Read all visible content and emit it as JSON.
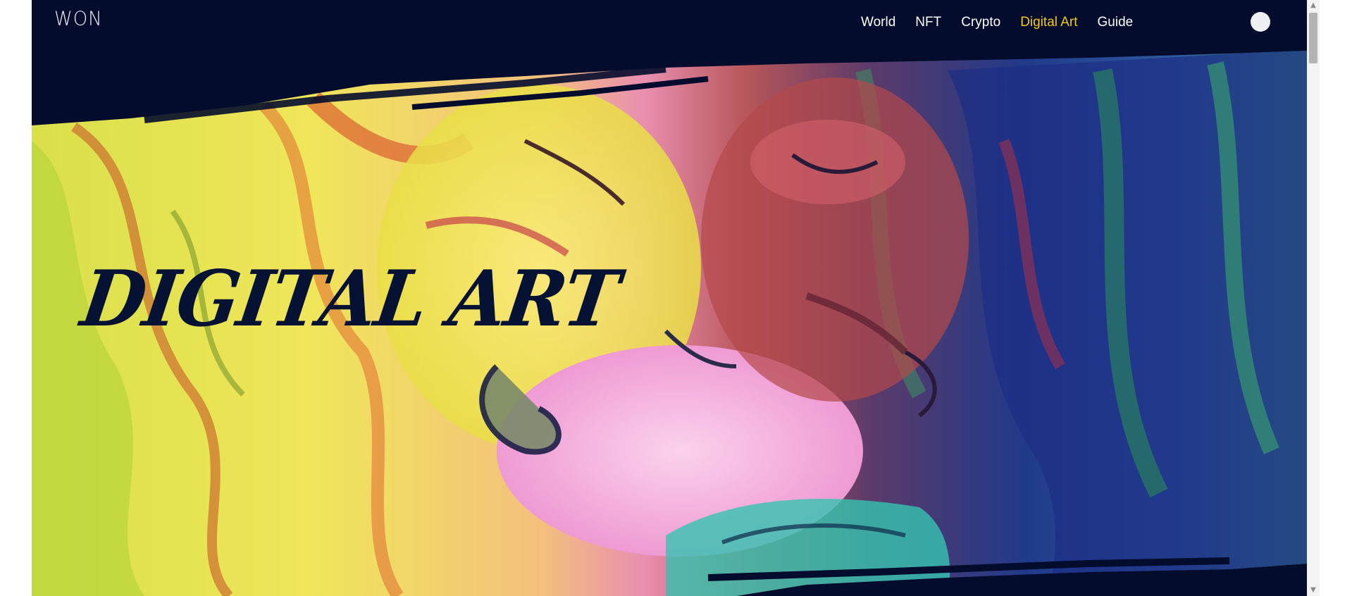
{
  "header": {
    "logo": "WON",
    "menu": [
      {
        "label": "World",
        "active": false
      },
      {
        "label": "NFT",
        "active": false
      },
      {
        "label": "Crypto",
        "active": false
      },
      {
        "label": "Digital Art",
        "active": true
      },
      {
        "label": "Guide",
        "active": false
      }
    ],
    "active_color": "#f1c81d"
  },
  "hero": {
    "title": "DIGITAL ART",
    "artwork_icon": "lion-painting"
  },
  "colors": {
    "background": "#030c2c",
    "title_color": "#061234"
  }
}
